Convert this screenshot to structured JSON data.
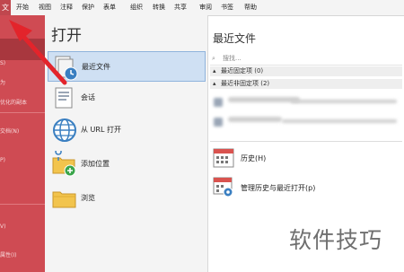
{
  "menubar": {
    "file_label": "文",
    "items": [
      "开始",
      "视图",
      "注释",
      "保护",
      "表单",
      "组织",
      "转换",
      "共享",
      "审阅",
      "书签",
      "帮助"
    ]
  },
  "left_pane": {
    "items": [
      "S)",
      "为",
      "优化的副本",
      "交档(N)",
      "P)",
      "V)",
      "属性(I)"
    ]
  },
  "open_panel": {
    "title": "打开",
    "options": [
      {
        "label": "最近文件",
        "icon": "recent-files-icon",
        "active": true
      },
      {
        "label": "会话",
        "icon": "session-icon",
        "active": false
      },
      {
        "label": "从 URL 打开",
        "icon": "globe-url-icon",
        "active": false
      },
      {
        "label": "添加位置",
        "icon": "add-location-folder-icon",
        "active": false
      },
      {
        "label": "浏览",
        "icon": "browse-folder-icon",
        "active": false
      }
    ]
  },
  "recent_panel": {
    "title": "最近文件",
    "search_placeholder": "搜找...",
    "pinned_header": "最近固定项 (0)",
    "unpinned_header": "最近非固定项 (2)",
    "files": [
      {
        "name_blurred": true,
        "has_pin": true
      },
      {
        "name_blurred": true,
        "has_pin": true
      }
    ],
    "links": [
      {
        "label": "历史(H)",
        "icon": "calendar-history-icon"
      },
      {
        "label": "管理历史与最近打开(p)",
        "icon": "calendar-gear-icon"
      }
    ]
  },
  "watermark": "软件技巧",
  "colors": {
    "accent_red": "#cf4b53",
    "selected_red": "#a8373e",
    "selected_blue": "#cfe0f3",
    "arrow_red": "#e3242b"
  }
}
